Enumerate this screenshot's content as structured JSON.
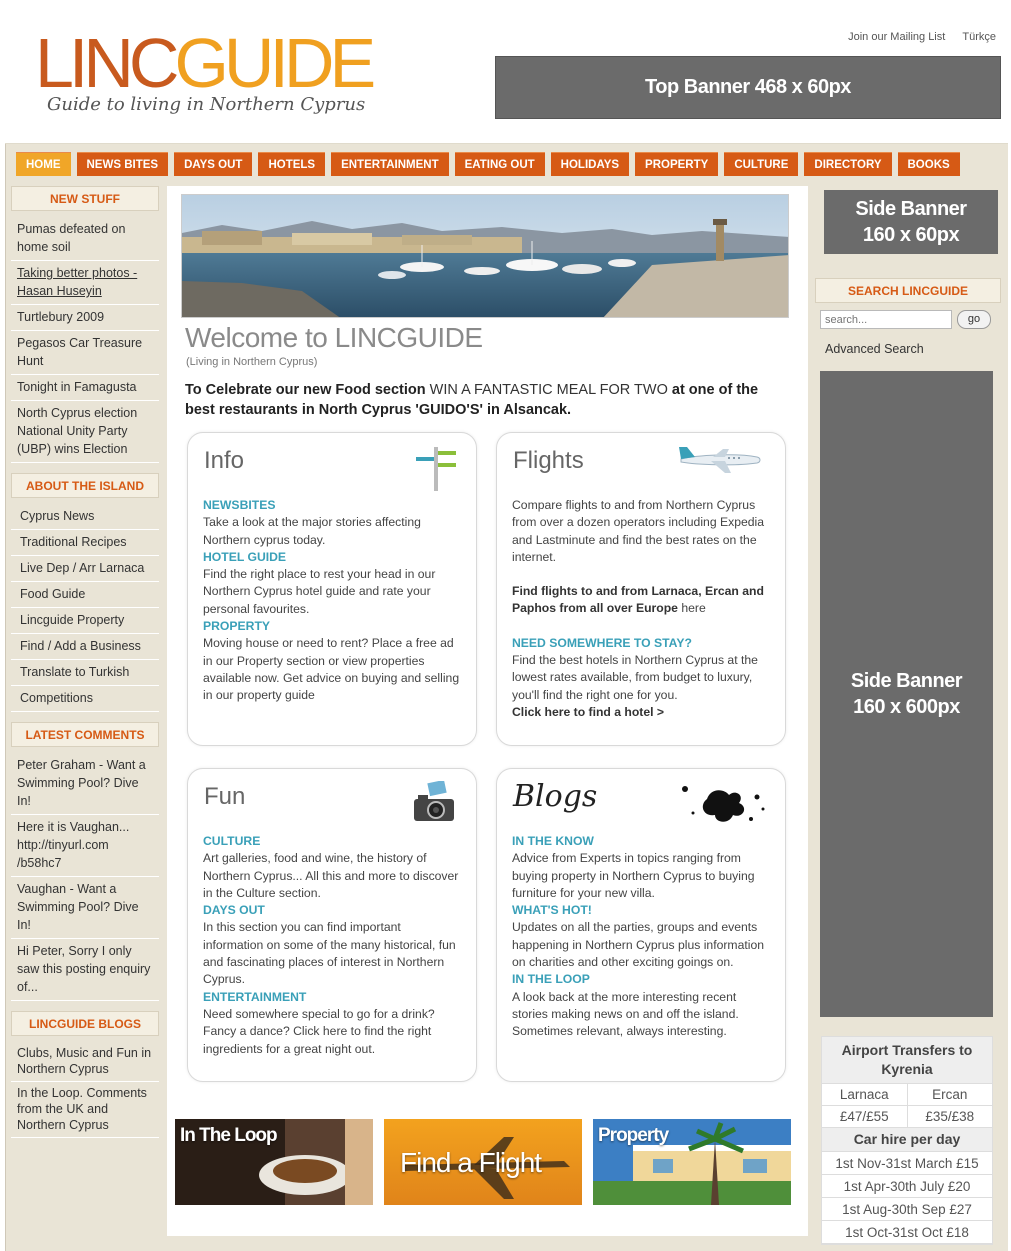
{
  "header": {
    "logo_linc": "LINC",
    "logo_guide": "GUIDE",
    "tagline": "Guide to living in Northern Cyprus",
    "mailing_list": "Join our Mailing List",
    "language": "Türkçe",
    "top_banner": "Top Banner 468 x 60px"
  },
  "nav": [
    "HOME",
    "NEWS BITES",
    "DAYS OUT",
    "HOTELS",
    "ENTERTAINMENT",
    "EATING OUT",
    "HOLIDAYS",
    "PROPERTY",
    "CULTURE",
    "DIRECTORY",
    "BOOKS"
  ],
  "left": {
    "new_stuff_title": "NEW STUFF",
    "new_stuff": [
      "Pumas defeated on home soil",
      "Taking better photos - Hasan Huseyin",
      "Turtlebury 2009",
      "Pegasos Car Treasure Hunt",
      "Tonight in Famagusta",
      "North Cyprus election National Unity Party (UBP) wins Election"
    ],
    "about_title": "ABOUT THE ISLAND",
    "about": [
      "Cyprus News",
      "Traditional Recipes",
      "Live Dep / Arr Larnaca",
      "Food Guide",
      "Lincguide Property",
      "Find / Add a Business",
      "Translate to Turkish",
      "Competitions"
    ],
    "comments_title": "LATEST COMMENTS",
    "comments": [
      "Peter Graham - Want a Swimming Pool? Dive In!",
      "Here it is Vaughan... http://tinyurl.com /b58hc7",
      "Vaughan - Want a Swimming Pool? Dive In!",
      "Hi Peter, Sorry I only saw this posting enquiry of..."
    ],
    "blogs_title": "LINCGUIDE BLOGS",
    "blogs": [
      "Clubs, Music and Fun in Northern Cyprus",
      "In the Loop. Comments from the UK and Northern Cyprus"
    ]
  },
  "main": {
    "welcome": "Welcome to LINCGUIDE",
    "welcome_sub": "(Living in Northern Cyprus)",
    "promo_a": "To Celebrate our new Food section",
    "promo_b": " WIN A FANTASTIC MEAL FOR TWO ",
    "promo_c": "at one of the best restaurants in North Cyprus 'GUIDO'S' in Alsancak.",
    "info": {
      "title": "Info",
      "h1": "NEWSBITES",
      "t1": "Take a look at the major stories affecting Northern cyprus today.",
      "h2": "HOTEL GUIDE",
      "t2": "Find the right place to rest your head in our Northern Cyprus hotel guide and rate your personal favourites.",
      "h3": "PROPERTY",
      "t3": "Moving house or need to rent? Place a free ad in our Property section or view properties available now. Get advice on buying and selling in our property guide"
    },
    "flights": {
      "title": "Flights",
      "t1": "Compare flights to and from Northern Cyprus from over a dozen operators including Expedia and Lastminute and find the best rates on the internet.",
      "t2_bold": "Find flights to and from Larnaca, Ercan and Paphos from all over Europe",
      "t2_link": " here",
      "h3": "NEED SOMEWHERE TO STAY?",
      "t3": "Find the best hotels in Northern Cyprus at the lowest rates available, from budget to luxury, you'll find the right one for you.",
      "t3_link": "Click here to find a hotel >"
    },
    "fun": {
      "title": "Fun",
      "h1": "CULTURE",
      "t1": "Art galleries, food and wine, the history of Northern Cyprus... All this and more to discover in the Culture section.",
      "h2": "DAYS OUT",
      "t2": "In this section you can find important information on some of the many historical, fun and fascinating places of interest in Northern Cyprus.",
      "h3": "ENTERTAINMENT",
      "t3": "Need somewhere special to go for a drink? Fancy a dance? Click here to find the right ingredients for a great night out."
    },
    "blogs": {
      "title": "Blogs",
      "h1": "IN THE KNOW",
      "t1": "Advice from Experts in topics ranging from buying property in Northern Cyprus to buying furniture for your new villa.",
      "h2": "WHAT'S HOT!",
      "t2": "Updates on all the parties, groups and events happening in Northern Cyprus plus information on charities and other exciting goings on.",
      "h3": "IN THE LOOP",
      "t3": "A look back at the more interesting recent stories making news on and off the island. Sometimes relevant, always interesting."
    },
    "tiles": [
      "In The Loop",
      "Find a Flight",
      "Property"
    ]
  },
  "right": {
    "side_banner_small_1": "Side Banner",
    "side_banner_small_2": "160 x 60px",
    "search_title": "SEARCH LINCGUIDE",
    "search_placeholder": "search...",
    "search_go": "go",
    "advanced_search": "Advanced Search",
    "side_banner_big_1": "Side Banner",
    "side_banner_big_2": "160 x 600px",
    "transfers_title": "Airport Transfers to Kyrenia",
    "transfers_cols": [
      "Larnaca",
      "Ercan"
    ],
    "transfers_prices": [
      "£47/£55",
      "£35/£38"
    ],
    "car_hire_title": "Car hire per day",
    "car_hire": [
      "1st Nov-31st March £15",
      "1st Apr-30th July £20",
      "1st Aug-30th Sep £27",
      "1st Oct-31st Oct £18"
    ]
  },
  "colors": {
    "accent_orange": "#d65a15",
    "nav_active": "#f0a628",
    "teal_heading": "#3aa0b8",
    "banner_gray": "#6b6b6b",
    "page_beige": "#e9e4d6"
  }
}
